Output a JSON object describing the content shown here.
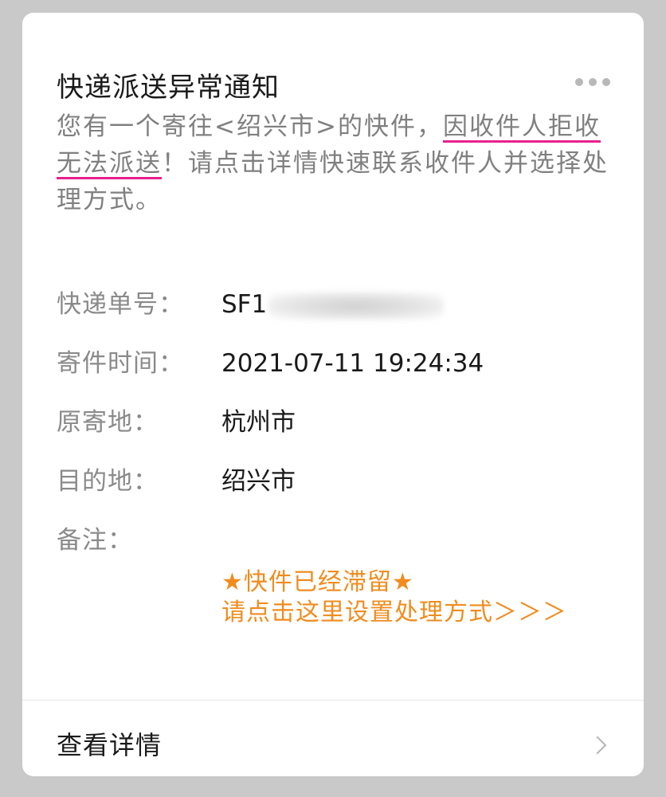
{
  "card": {
    "title": "快递派送异常通知",
    "more_icon": "more-horizontal-icon",
    "description": {
      "before": "您有一个寄往<绍兴市>的快件，",
      "underline1": "因收件人拒收",
      "underline2": "无法派送",
      "after": "！请点击详情快速联系收件人并选择处理方式。",
      "underline_color": "#e8208d"
    },
    "fields": [
      {
        "label": "快递单号：",
        "value": "SF1"
      },
      {
        "label": "寄件时间：",
        "value": "2021-07-11 19:24:34"
      },
      {
        "label": "原寄地：",
        "value": "杭州市"
      },
      {
        "label": "目的地：",
        "value": "绍兴市"
      },
      {
        "label": "备注：",
        "value": ""
      }
    ],
    "notice": {
      "line1": "★快件已经滞留★",
      "line2": "请点击这里设置处理方式＞＞＞",
      "color": "#f08c1e"
    },
    "footer": {
      "label": "查看详情",
      "icon": "chevron-right-icon"
    }
  }
}
